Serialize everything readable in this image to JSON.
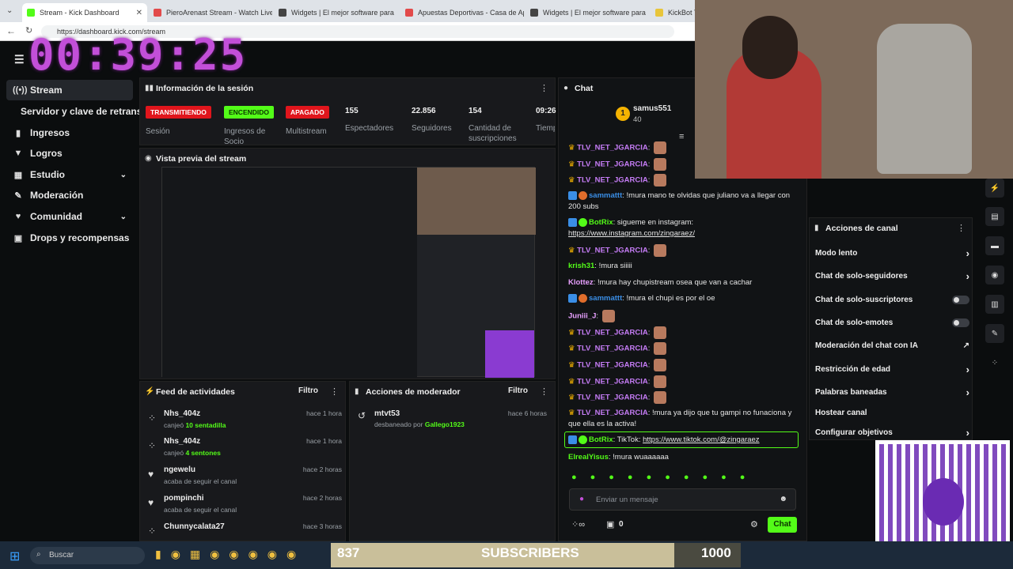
{
  "browser": {
    "tabs": [
      {
        "label": "Stream - Kick Dashboard",
        "color": "#53fc18"
      },
      {
        "label": "PieroArenast Stream - Watch Live",
        "color": "#e24a4a"
      },
      {
        "label": "Widgets | El mejor software para",
        "color": "#333333"
      },
      {
        "label": "Apuestas Deportivas - Casa de Ap",
        "color": "#e24a4a"
      },
      {
        "label": "Widgets | El mejor software para",
        "color": "#333333"
      },
      {
        "label": "KickBot TT",
        "color": "#e8c53a"
      }
    ],
    "url": "https://dashboard.kick.com/stream"
  },
  "overlay": {
    "timer": "00:39:25",
    "subs_current": "837",
    "subs_label": "SUBSCRIBERS",
    "subs_goal": "1000",
    "subs_progress": 0.837
  },
  "sidebar": {
    "items": [
      {
        "label": "Stream",
        "icon": "broadcast-icon"
      },
      {
        "label": "Servidor y clave de retransmisión"
      },
      {
        "label": "Ingresos",
        "icon": "bar-chart-icon"
      },
      {
        "label": "Logros",
        "icon": "trophy-icon"
      },
      {
        "label": "Estudio",
        "icon": "grid-icon"
      },
      {
        "label": "Moderación",
        "icon": "wrench-icon"
      },
      {
        "label": "Comunidad",
        "icon": "heart-icon"
      },
      {
        "label": "Drops y recompensas",
        "icon": "gift-icon"
      }
    ]
  },
  "session": {
    "title": "Información de la sesión",
    "stats": [
      {
        "badge": "TRANSMITIENDO",
        "label": "Sesión",
        "color": "#e0151c"
      },
      {
        "badge": "ENCENDIDO",
        "label": "Ingresos de Socio",
        "color": "#53fc18"
      },
      {
        "badge": "APAGADO",
        "label": "Multistream",
        "color": "#e0151c"
      },
      {
        "value": "155",
        "label": "Espectadores"
      },
      {
        "value": "22.856",
        "label": "Seguidores"
      },
      {
        "value": "154",
        "label": "Cantidad de suscripciones"
      },
      {
        "value": "09:26",
        "label": "Tiempo en vivo"
      }
    ]
  },
  "preview": {
    "title": "Vista previa del stream"
  },
  "feed": {
    "title": "Feed de actividades",
    "filter": "Filtro",
    "items": [
      {
        "user": "Nhs_404z",
        "desc": "canjeó",
        "hl": "10 sentadilla",
        "time": "hace 1 hora",
        "icon": "points-icon"
      },
      {
        "user": "Nhs_404z",
        "desc": "canjeó",
        "hl": "4 sentones",
        "time": "hace 1 hora",
        "icon": "points-icon"
      },
      {
        "user": "ngewelu",
        "desc": "acaba de seguir el canal",
        "hl": "",
        "time": "hace 2 horas",
        "icon": "heart-icon"
      },
      {
        "user": "pompinchi",
        "desc": "acaba de seguir el canal",
        "hl": "",
        "time": "hace 2 horas",
        "icon": "heart-icon"
      },
      {
        "user": "Chunnycalata27",
        "desc": "",
        "hl": "",
        "time": "hace 3 horas",
        "icon": "points-icon"
      }
    ]
  },
  "modactions": {
    "title": "Acciones de moderador",
    "filter": "Filtro",
    "items": [
      {
        "user": "mtvt53",
        "desc": "desbaneado por",
        "by": "Gallego1923",
        "time": "hace 6 horas"
      }
    ]
  },
  "chat": {
    "title": "Chat",
    "pinned": {
      "user": "samus551",
      "rank": "1",
      "count": "40"
    },
    "messages": [
      {
        "user": "TLV_NET_JGARCIA",
        "text": "",
        "kind": "crown",
        "emote": true
      },
      {
        "user": "TLV_NET_JGARCIA",
        "text": "",
        "kind": "crown",
        "emote": true
      },
      {
        "user": "TLV_NET_JGARCIA",
        "text": "",
        "kind": "crown",
        "emote": true
      },
      {
        "user": "sammattt",
        "text": "!mura mano te olvidas que juliano va a llegar con 200 subs",
        "kind": "vip"
      },
      {
        "user": "BotRix",
        "text": "sigueme en instagram:",
        "link": "https://www.instagram.com/zingaraez/",
        "kind": "bot"
      },
      {
        "user": "TLV_NET_JGARCIA",
        "text": "",
        "kind": "crown",
        "emote": true
      },
      {
        "user": "krish31",
        "text": "!mura siiiii",
        "kind": "plain",
        "ucolor": "#53fc18"
      },
      {
        "user": "Klottez",
        "text": "!mura hay chupistream osea que van a cachar",
        "kind": "plain",
        "ucolor": "#e8a0ff"
      },
      {
        "user": "sammattt",
        "text": "!mura el chupi es por el oe",
        "kind": "vip"
      },
      {
        "user": "Juniii_J",
        "text": "",
        "kind": "plain",
        "ucolor": "#e8a0ff",
        "emote": true
      },
      {
        "user": "TLV_NET_JGARCIA",
        "text": "",
        "kind": "crown",
        "emote": true
      },
      {
        "user": "TLV_NET_JGARCIA",
        "text": "",
        "kind": "crown",
        "emote": true
      },
      {
        "user": "TLV_NET_JGARCIA",
        "text": "",
        "kind": "crown",
        "emote": true
      },
      {
        "user": "TLV_NET_JGARCIA",
        "text": "",
        "kind": "crown",
        "emote": true
      },
      {
        "user": "TLV_NET_JGARCIA",
        "text": "",
        "kind": "crown",
        "emote": true
      },
      {
        "user": "TLV_NET_JGARCIA",
        "text": "!mura ya dijo que tu gampi no funaciona y que ella es la activa!",
        "kind": "crown"
      },
      {
        "user": "BotRix",
        "text": "TikTok:",
        "link": "https://www.tiktok.com/@zingaraez",
        "kind": "bot"
      },
      {
        "user": "ElrealYisus",
        "text": "!mura wuaaaaaa",
        "kind": "plain",
        "ucolor": "#53fc18"
      }
    ],
    "input_placeholder": "Enviar un mensaje",
    "points": "0",
    "send_label": "Chat"
  },
  "actions": {
    "title": "Acciones de canal",
    "rows": [
      {
        "label": "Modo lento",
        "ctl": "chevron"
      },
      {
        "label": "Chat de solo-seguidores",
        "ctl": "chevron"
      },
      {
        "label": "Chat de solo-suscriptores",
        "ctl": "toggle"
      },
      {
        "label": "Chat de solo-emotes",
        "ctl": "toggle"
      },
      {
        "label": "Moderación del chat con IA",
        "ctl": "external"
      },
      {
        "label": "Restricción de edad",
        "ctl": "chevron"
      },
      {
        "label": "Palabras baneadas",
        "ctl": "chevron"
      },
      {
        "label": "Hostear canal",
        "ctl": "none"
      },
      {
        "label": "Configurar objetivos",
        "ctl": "chevron"
      }
    ]
  },
  "taskbar": {
    "search": "Buscar"
  },
  "colors": {
    "accent": "#53fc18",
    "danger": "#e0151c",
    "timer": "#c24fd8"
  }
}
